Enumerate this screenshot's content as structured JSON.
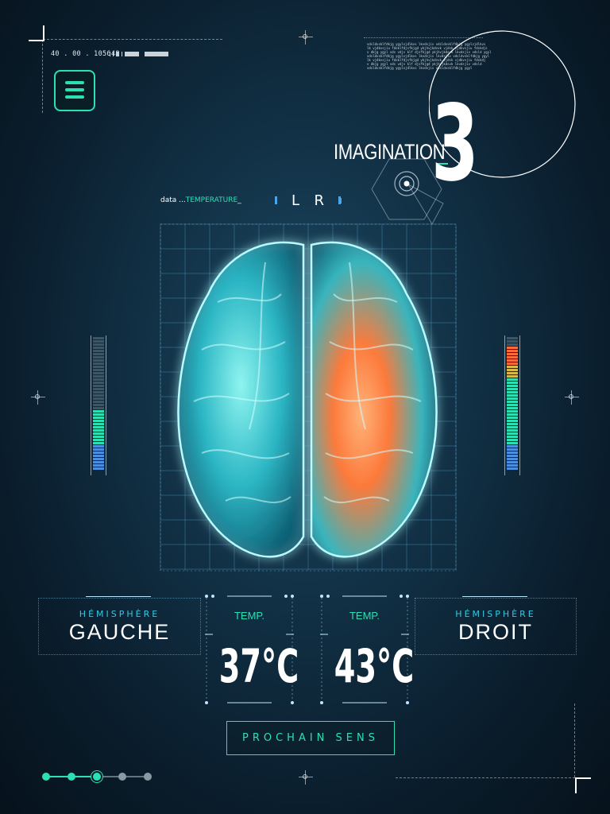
{
  "header": {
    "code": "40 . 00 . 105648",
    "category": "IMAGINATION",
    "number": "3",
    "fine_print": "vdsldvsklfdkjg ygylvjdlkvs lkvdsjiv vdsldvsklfdkjg ygylvjdlkvs\nlk vjdkvsjiu fdsklfdjsfkjgd ykjhvjkdsvk vjdsk vjdkvsjiu fdskdjs\nv dkjg ygyl vds vdjs klf djsfkjgd ykjhvjkdsvk lkvdsjiv vdsld ygyl\nvdsldvsklfdkjg ygylvjdlkvs lkvdsjiv lkvdsjiv vdsldvsklfdkjg ygyl\nlk vjdkvsjiu fdsklfdjsfkjgd ykjhvjkdsvk vjdsk vjdkvsjiu fdskdj\nv dkjg ygyl vds vdjs klf djsfkjgd ykjhvjkdsvk lkvdsjiv vdsld\nvdsldvsklfdkjg ygylvjdlkvs lkvdsjiv vdsldvsklfdkjg ygyl"
  },
  "menu": {
    "icon": "hamburger-icon"
  },
  "scan": {
    "data_prefix": "data ...",
    "data_label": "TEMPERATURE",
    "data_suffix": "_",
    "left_letter": "L",
    "right_letter": "R"
  },
  "left_panel": {
    "subtitle": "HÉMISPHÈRE",
    "title": "GAUCHE"
  },
  "right_panel": {
    "subtitle": "HÉMISPHÈRE",
    "title": "DROIT"
  },
  "left_temp": {
    "label": "TEMP.",
    "value": "37°C"
  },
  "right_temp": {
    "label": "TEMP.",
    "value": "43°C"
  },
  "next_button": {
    "label": "PROCHAIN SENS"
  },
  "meters": {
    "left_level": 0.45,
    "right_level": 0.92
  },
  "pager": {
    "total": 5,
    "current": 3
  },
  "colors": {
    "accent": "#2de0b3",
    "cyan": "#34c8e0",
    "hot": "#ff7a3a",
    "background": "#0a1d2c"
  }
}
